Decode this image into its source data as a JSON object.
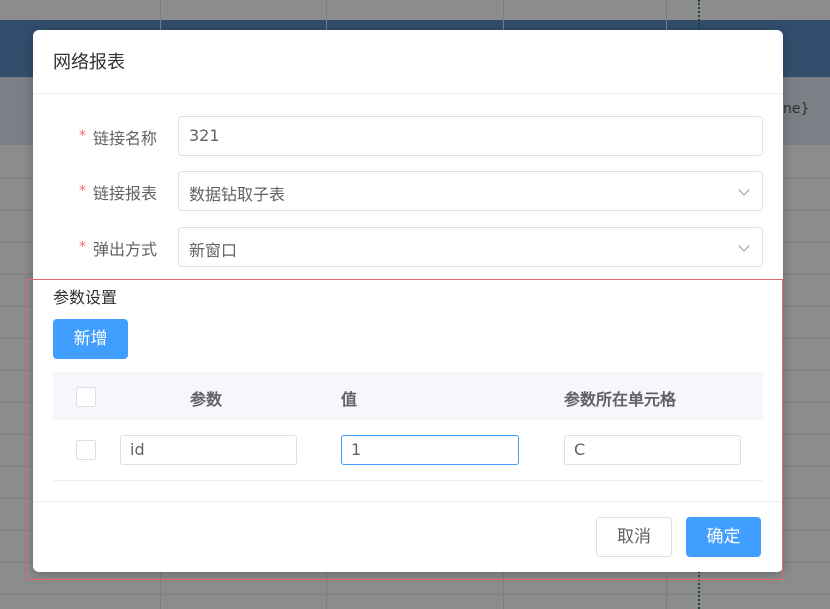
{
  "background": {
    "partial_text": "ne}"
  },
  "dialog": {
    "title": "网络报表",
    "form": {
      "link_name": {
        "label": "链接名称",
        "value": "321"
      },
      "link_report": {
        "label": "链接报表",
        "value": "数据钻取子表"
      },
      "popup_mode": {
        "label": "弹出方式",
        "value": "新窗口"
      }
    },
    "params": {
      "section_title": "参数设置",
      "add_label": "新增",
      "columns": [
        "参数",
        "值",
        "参数所在单元格"
      ],
      "rows": [
        {
          "param": "id",
          "value": "1",
          "cell": "C"
        }
      ]
    },
    "footer": {
      "cancel_label": "取消",
      "confirm_label": "确定"
    }
  },
  "colors": {
    "primary": "#409eff",
    "required": "#f56c6c",
    "highlight_frame": "#e46a6a"
  }
}
